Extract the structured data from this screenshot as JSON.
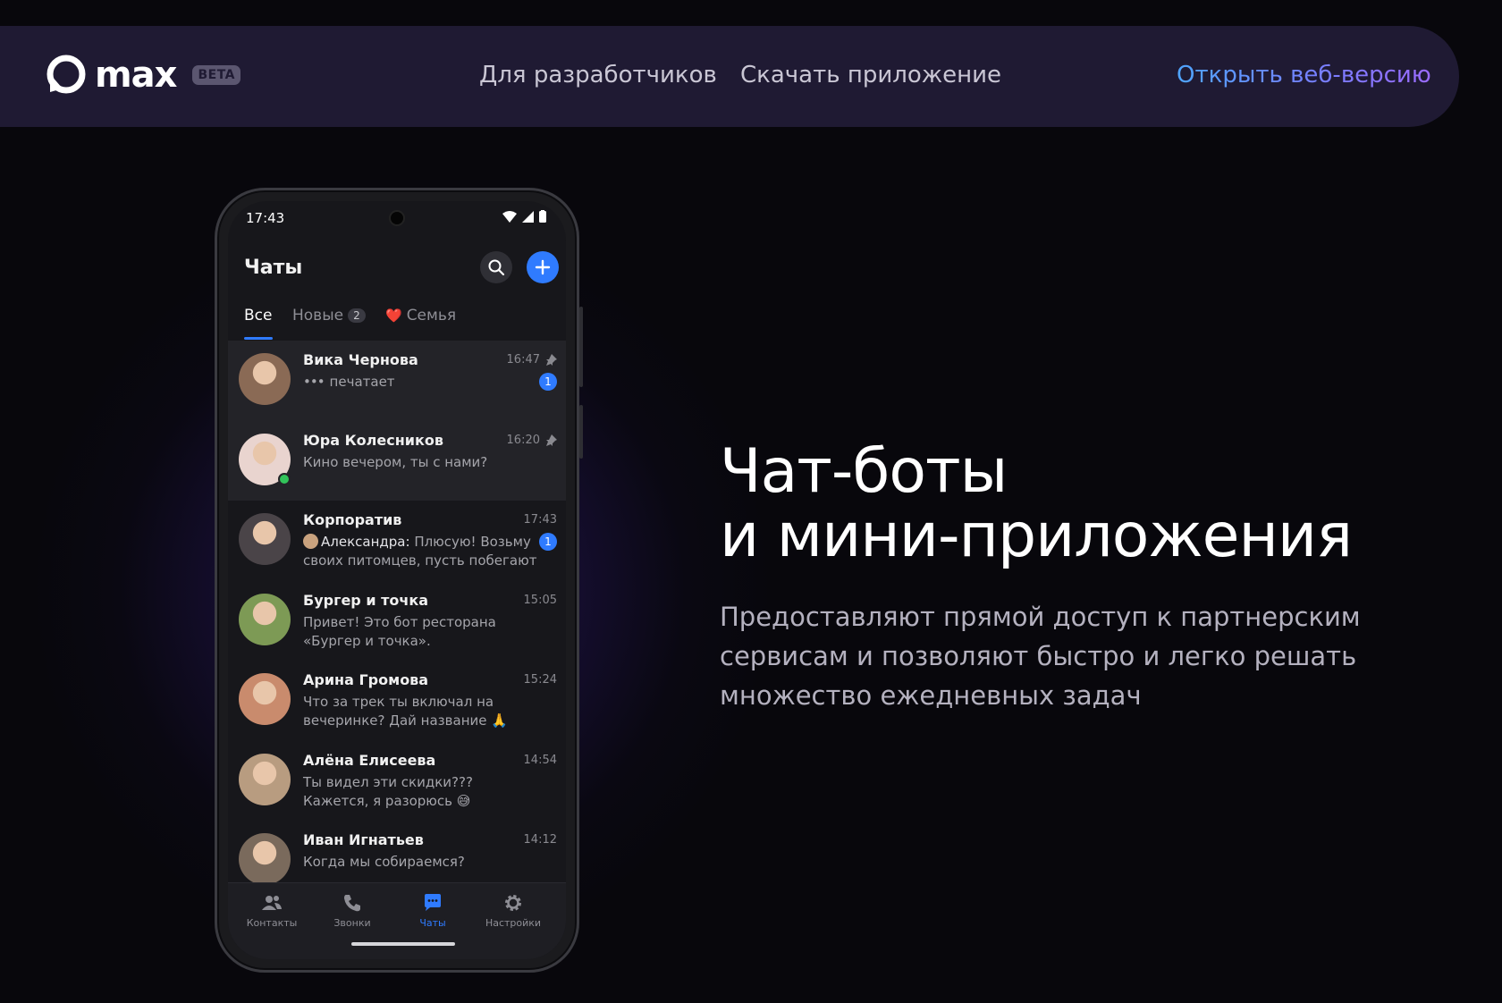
{
  "nav": {
    "brand": "max",
    "beta": "BETA",
    "links": [
      "Для разработчиков",
      "Скачать приложение"
    ],
    "cta": "Открыть веб-версию"
  },
  "phone": {
    "time": "17:43",
    "title": "Чаты",
    "tabs": [
      {
        "label": "Все",
        "active": true
      },
      {
        "label": "Новые",
        "badge": "2"
      },
      {
        "label": "Семья",
        "emoji": "❤️"
      }
    ],
    "chats": [
      {
        "name": "Вика Чернова",
        "time": "16:47",
        "message": "печатает",
        "typing": true,
        "pinned": true,
        "unread": "1",
        "avatar_color": "#8a6a55"
      },
      {
        "name": "Юра Колесников",
        "time": "16:20",
        "message": "Кино вечером, ты с нами?",
        "pinned": true,
        "online": true,
        "avatar_color": "#e9d4cf"
      },
      {
        "name": "Корпоратив",
        "time": "17:43",
        "author": "Александра:",
        "message": "Плюсую! Возьму своих питомцев, пусть побегают",
        "unread": "1",
        "avatar_color": "#4a4448"
      },
      {
        "name": "Бургер и точка",
        "time": "15:05",
        "message": "Привет! Это бот ресторана «Бургер и точка».",
        "avatar_color": "#7d9a55"
      },
      {
        "name": "Арина Громова",
        "time": "15:24",
        "message": "Что за трек ты включал на вечеринке? Дай название 🙏",
        "avatar_color": "#c98b6d"
      },
      {
        "name": "Алёна Елисеева",
        "time": "14:54",
        "message": "Ты видел эти скидки??? Кажется, я разорюсь 😅",
        "avatar_color": "#b89c80"
      },
      {
        "name": "Иван Игнатьев",
        "time": "14:12",
        "message": "Когда мы собираемся?",
        "avatar_color": "#7a6a5c"
      }
    ],
    "tabbar": [
      {
        "label": "Контакты",
        "icon": "contacts-icon"
      },
      {
        "label": "Звонки",
        "icon": "phone-icon"
      },
      {
        "label": "Чаты",
        "icon": "chat-icon",
        "active": true
      },
      {
        "label": "Настройки",
        "icon": "gear-icon"
      }
    ]
  },
  "hero": {
    "title_line1": "Чат-боты",
    "title_line2": "и мини-приложения",
    "subtitle": "Предоставляют прямой доступ к партнерским сервисам и позволяют быстро и легко решать множество ежедневных задач"
  },
  "colors": {
    "accent": "#2f7bff",
    "nav_bg": "#1f1a33",
    "online": "#32c35a"
  }
}
